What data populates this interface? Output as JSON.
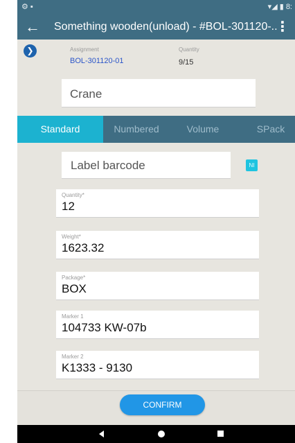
{
  "status_bar": {
    "left_icons": "⚙ ▪",
    "right_icons": "▾◢ ▮ 8:"
  },
  "app_bar": {
    "back_icon": "arrow-left-icon",
    "title": "Something wooden(unload) - #BOL-301120-...",
    "menu_icon": "more-vert-icon"
  },
  "info": {
    "assignment_label": "Assignment",
    "assignment_value": "BOL-301120-01",
    "quantity_label": "Quantity",
    "quantity_value": "9/15"
  },
  "crane_input": {
    "value": "Crane"
  },
  "tabs": [
    {
      "label": "Standard",
      "active": true
    },
    {
      "label": "Numbered",
      "active": false
    },
    {
      "label": "Volume",
      "active": false
    },
    {
      "label": "SPack",
      "active": false
    }
  ],
  "barcode": {
    "placeholder": "Label barcode",
    "toggle_label": "NI"
  },
  "fields": [
    {
      "label": "Quantity*",
      "value": "12"
    },
    {
      "label": "Weight*",
      "value": "1623.32"
    },
    {
      "label": "Package*",
      "value": "BOX"
    },
    {
      "label": "Marker 1",
      "value": "104733 KW-07b"
    },
    {
      "label": "Marker 2",
      "value": "K1333 - 9130"
    }
  ],
  "confirm_label": "CONFIRM",
  "colors": {
    "primary": "#3f6d83",
    "tab_active": "#1cb2d0",
    "confirm": "#2196e6",
    "link": "#2b55c9"
  }
}
